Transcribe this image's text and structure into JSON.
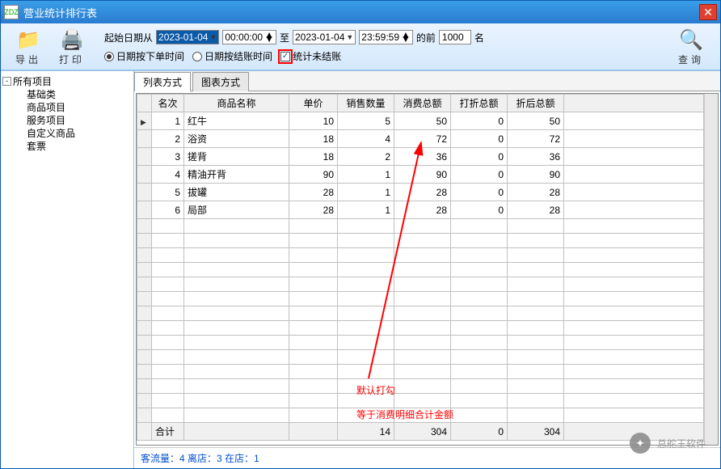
{
  "window": {
    "title": "营业统计排行表"
  },
  "toolbar": {
    "export_label": "导出",
    "print_label": "打印",
    "search_label": "查询",
    "date_from_label": "起始日期从",
    "date_to_label": "至",
    "before_label": "的前",
    "unit_label": "名",
    "date_from": "2023-01-04",
    "time_from": "00:00:00",
    "date_to": "2023-01-04",
    "time_to": "23:59:59",
    "top_n": "1000",
    "radio1": "日期按下单时间",
    "radio2": "日期按结账时间",
    "checkbox1": "统计未结账"
  },
  "tree": {
    "root": "所有项目",
    "children": [
      "基础类",
      "商品项目",
      "服务项目",
      "自定义商品",
      "套票"
    ]
  },
  "tabs": {
    "tab1": "列表方式",
    "tab2": "图表方式"
  },
  "table": {
    "headers": [
      "名次",
      "商品名称",
      "单价",
      "销售数量",
      "消费总额",
      "打折总额",
      "折后总额"
    ],
    "rows": [
      {
        "rank": "1",
        "name": "红牛",
        "price": "10",
        "qty": "5",
        "total": "50",
        "discount": "0",
        "after": "50"
      },
      {
        "rank": "2",
        "name": "浴资",
        "price": "18",
        "qty": "4",
        "total": "72",
        "discount": "0",
        "after": "72"
      },
      {
        "rank": "3",
        "name": "搓背",
        "price": "18",
        "qty": "2",
        "total": "36",
        "discount": "0",
        "after": "36"
      },
      {
        "rank": "4",
        "name": "精油开背",
        "price": "90",
        "qty": "1",
        "total": "90",
        "discount": "0",
        "after": "90"
      },
      {
        "rank": "5",
        "name": "拔罐",
        "price": "28",
        "qty": "1",
        "total": "28",
        "discount": "0",
        "after": "28"
      },
      {
        "rank": "6",
        "name": "局部",
        "price": "28",
        "qty": "1",
        "total": "28",
        "discount": "0",
        "after": "28"
      }
    ],
    "total_label": "合计",
    "totals": {
      "qty": "14",
      "total": "304",
      "discount": "0",
      "after": "304"
    }
  },
  "status": "客流量：4 离店：3 在店：1",
  "annotation": {
    "line1": "默认打勾",
    "line2": "等于消费明细合计金额"
  },
  "watermark": "总舵王软件"
}
